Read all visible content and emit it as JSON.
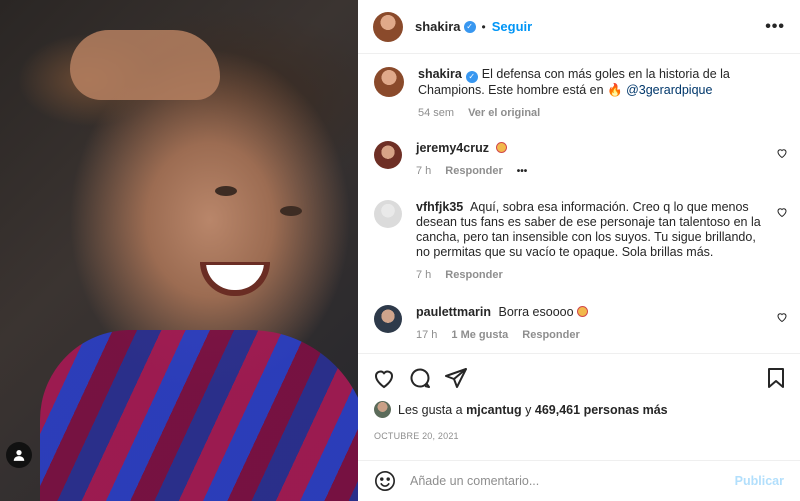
{
  "post": {
    "photo_alt_icon": "user-tag-icon"
  },
  "header": {
    "username": "shakira",
    "verified_glyph": "✓",
    "separator": "•",
    "follow_label": "Seguir",
    "more_label": "•••"
  },
  "caption": {
    "username": "shakira",
    "text_before": "El defensa con más goles en la historia de la Champions. Este hombre está en",
    "mention": "@3gerardpique",
    "age": "54 sem",
    "translate_label": "Ver el original"
  },
  "comments": [
    {
      "username": "jeremy4cruz",
      "text": "",
      "time": "7 h",
      "reply_label": "Responder",
      "more": "•••"
    },
    {
      "username": "vfhfjk35",
      "text": "Aquí, sobra esa información. Creo q lo que menos desean tus fans es saber de ese personaje tan talentoso en la cancha, pero tan insensible con los suyos. Tu sigue brillando, no permitas que su vacío te opaque. Sola brillas más.",
      "time": "7 h",
      "reply_label": "Responder"
    },
    {
      "username": "paulettmarin",
      "text": "Borra esoooo",
      "time": "17 h",
      "likes_label": "1 Me gusta",
      "reply_label": "Responder"
    }
  ],
  "likes": {
    "prefix": "Les gusta a",
    "first_user": "mjcantug",
    "joiner": "y",
    "others": "469,461 personas más"
  },
  "date": "OCTUBRE 20, 2021",
  "add_comment": {
    "placeholder": "Añade un comentario...",
    "publish_label": "Publicar"
  },
  "colors": {
    "accent": "#0095f6",
    "publish_disabled": "#b2dffc",
    "muted": "#8e8e8e"
  }
}
